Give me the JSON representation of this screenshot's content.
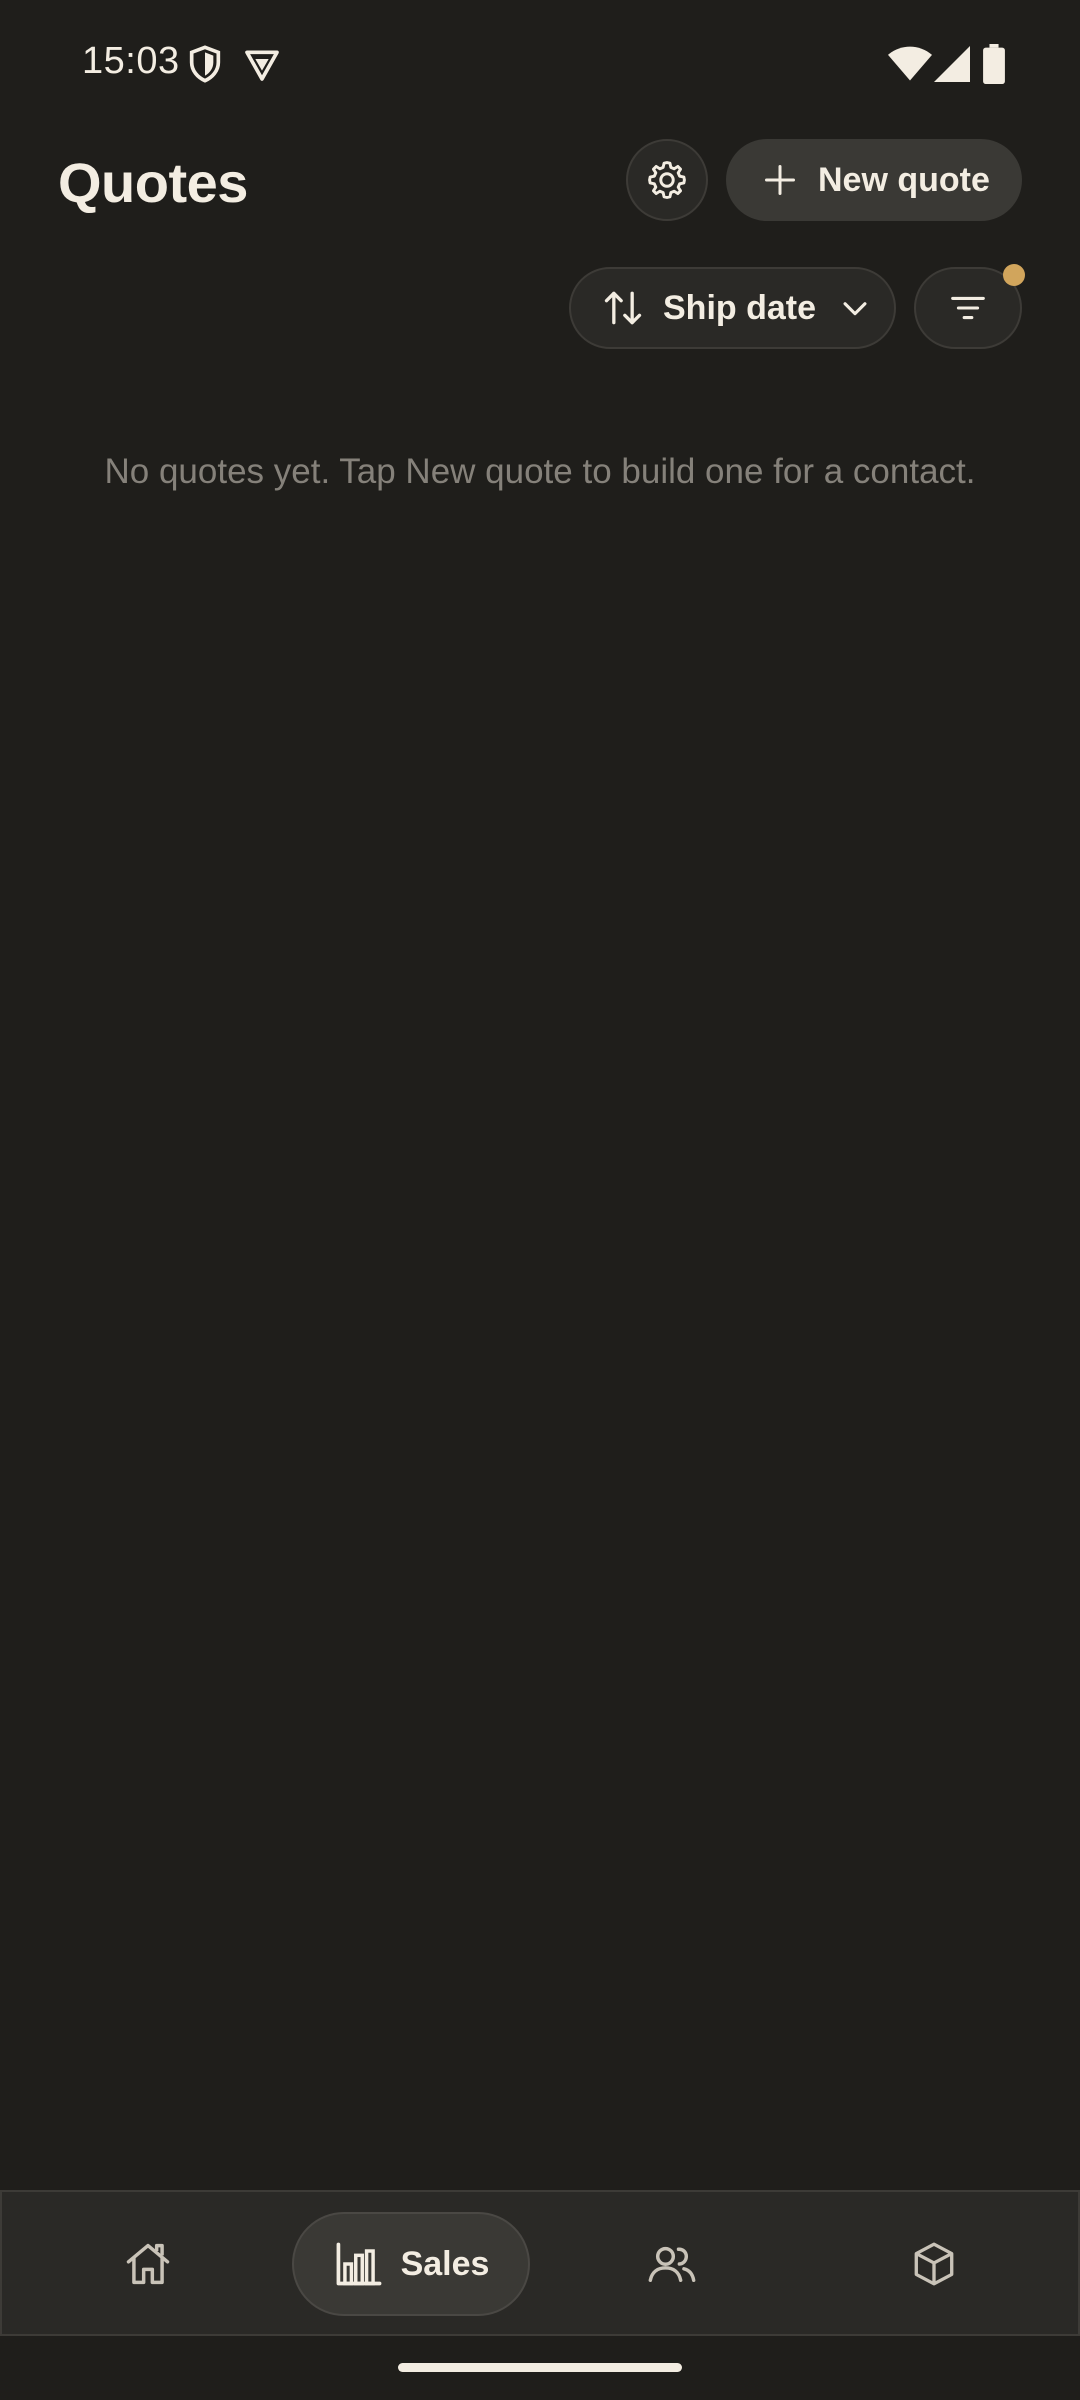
{
  "status_bar": {
    "time": "15:03",
    "left_icons": [
      "shield-icon",
      "vpn-icon"
    ],
    "right_icons": [
      "wifi-icon",
      "signal-icon",
      "battery-icon"
    ]
  },
  "header": {
    "title": "Quotes",
    "settings_icon": "gear-icon",
    "new_quote_label": "New quote"
  },
  "toolbar": {
    "sort_label": "Ship date",
    "sort_icon": "sort-arrows-icon",
    "filter_icon": "filter-icon",
    "filter_active": true
  },
  "empty_state": {
    "message": "No quotes yet. Tap New quote to build one for a contact."
  },
  "bottom_nav": {
    "items": [
      {
        "id": "home",
        "icon": "home-icon",
        "label": "",
        "selected": false
      },
      {
        "id": "sales",
        "icon": "bar-chart-icon",
        "label": "Sales",
        "selected": true
      },
      {
        "id": "contacts",
        "icon": "people-icon",
        "label": "",
        "selected": false
      },
      {
        "id": "products",
        "icon": "box-icon",
        "label": "",
        "selected": false
      }
    ]
  },
  "colors": {
    "background": "#1f1e1b",
    "surface": "#2a2926",
    "accent_dot": "#d1a55c",
    "text_primary": "#f3ede2",
    "text_muted": "#85817a"
  }
}
